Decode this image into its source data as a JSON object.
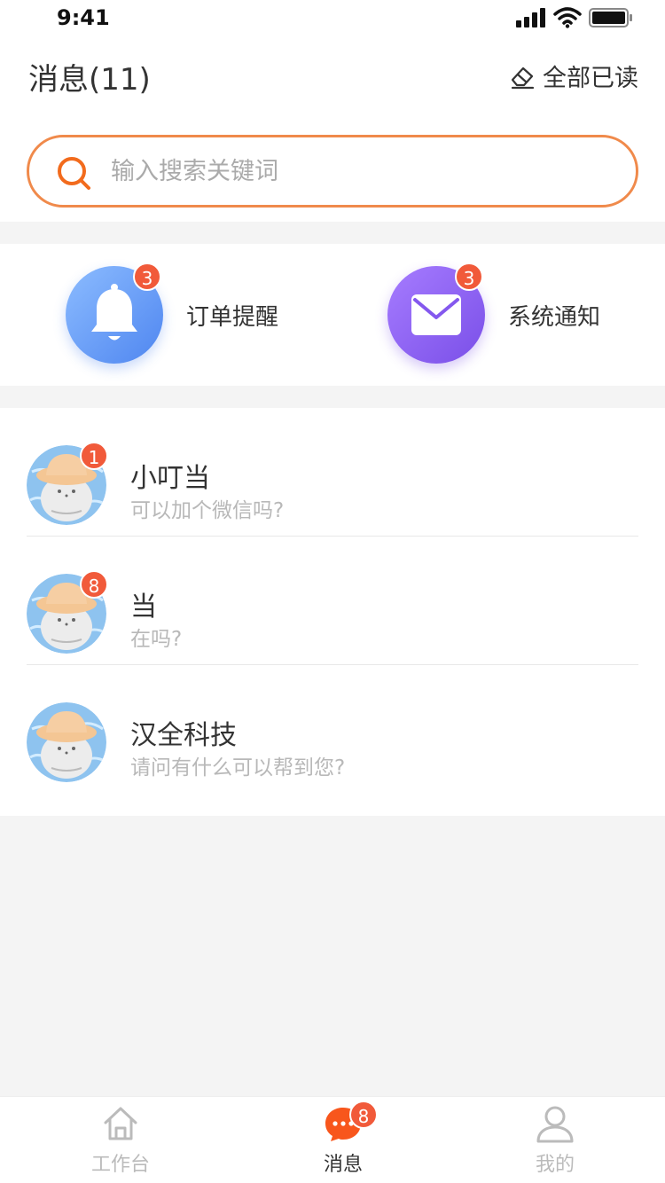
{
  "status_bar": {
    "time": "9:41"
  },
  "header": {
    "title": "消息(11)",
    "mark_all_read": "全部已读"
  },
  "search": {
    "placeholder": "输入搜索关键词"
  },
  "quick": [
    {
      "label": "订单提醒",
      "badge": "3",
      "icon": "bell-icon",
      "color": "#5b8ff2"
    },
    {
      "label": "系统通知",
      "badge": "3",
      "icon": "mail-icon",
      "color": "#8458ee"
    }
  ],
  "conversations": [
    {
      "name": "小叮当",
      "message": "可以加个微信吗?",
      "badge": "1"
    },
    {
      "name": "当",
      "message": "在吗?",
      "badge": "8"
    },
    {
      "name": "汉全科技",
      "message": "请问有什么可以帮到您?",
      "badge": ""
    }
  ],
  "tabs": [
    {
      "label": "工作台",
      "icon": "home-icon",
      "active": false
    },
    {
      "label": "消息",
      "icon": "chat-bubble-icon",
      "active": true,
      "badge": "8"
    },
    {
      "label": "我的",
      "icon": "user-icon",
      "active": false
    }
  ],
  "colors": {
    "accent": "#f15a3a",
    "search_border": "#f08a4b",
    "orange_icon": "#f26b1d"
  }
}
